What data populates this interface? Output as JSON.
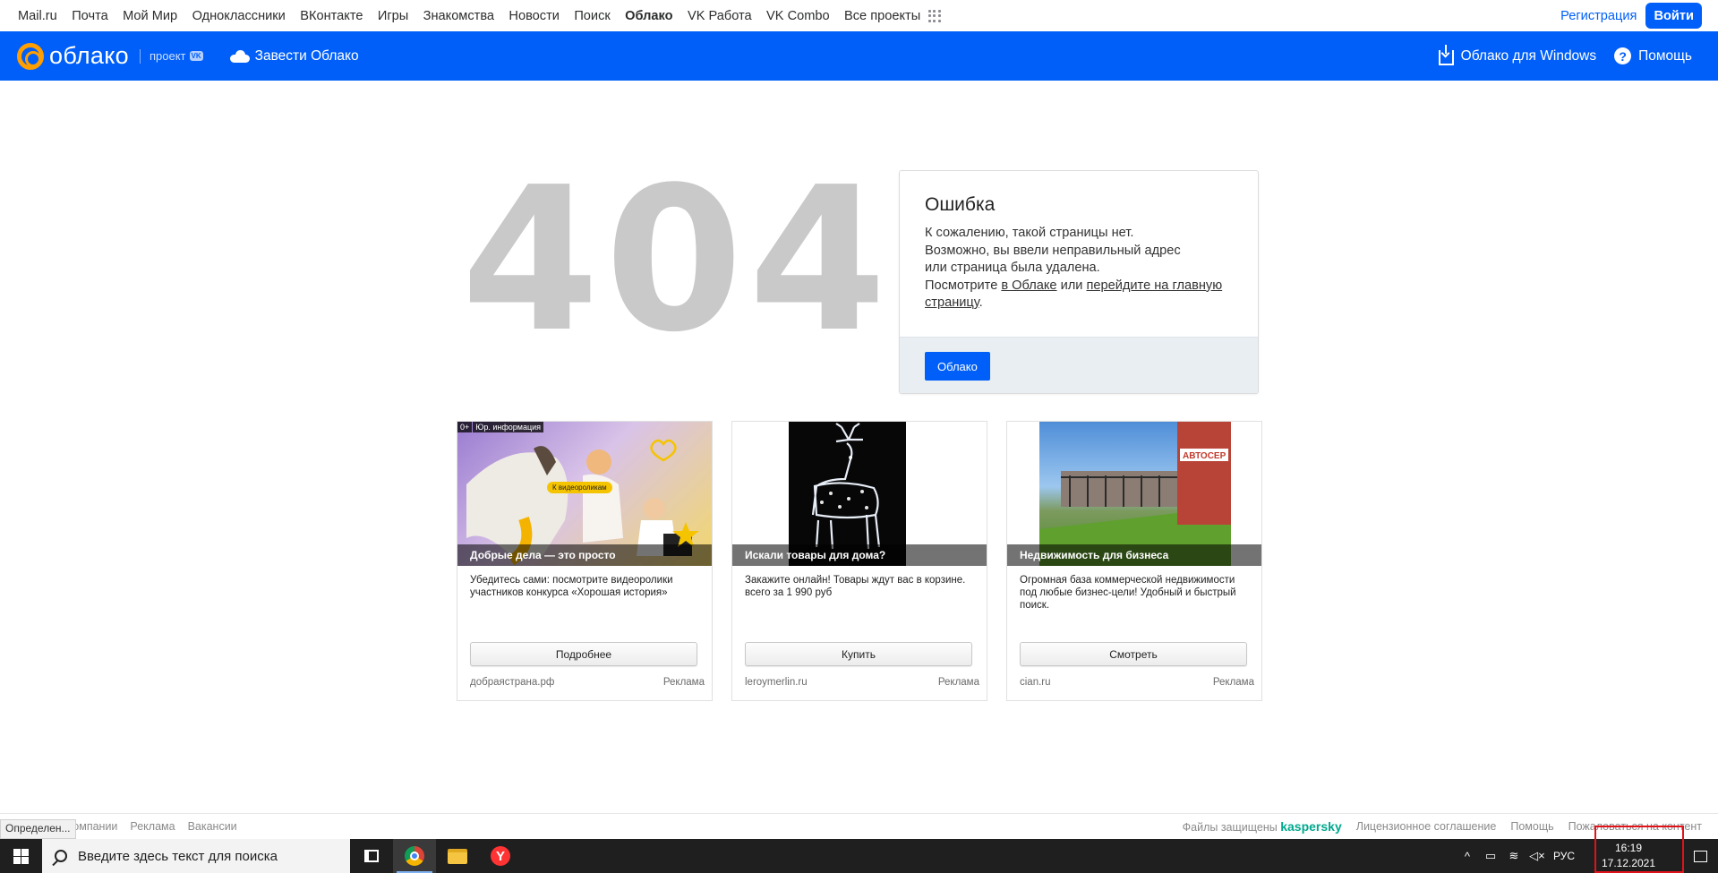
{
  "portal": {
    "links": [
      "Mail.ru",
      "Почта",
      "Мой Мир",
      "Одноклассники",
      "ВКонтакте",
      "Игры",
      "Знакомства",
      "Новости",
      "Поиск",
      "Облако",
      "VK Работа",
      "VK Combo",
      "Все проекты"
    ],
    "active": "Облако",
    "register": "Регистрация",
    "login": "Войти"
  },
  "header": {
    "logo_text": "облако",
    "project_label": "проект",
    "project_badge": "VK",
    "get_cloud": "Завести Облако",
    "windows": "Облако для Windows",
    "help": "Помощь"
  },
  "error": {
    "code": "404",
    "title": "Ошибка",
    "line1": "К сожалению, такой страницы нет.",
    "line2": "Возможно, вы ввели неправильный адрес",
    "line3": "или страница была удалена.",
    "line4_prefix": "Посмотрите ",
    "link_cloud": "в Облаке",
    "line4_mid": " или ",
    "link_main": "перейдите на главную страницу",
    "line4_end": ".",
    "button": "Облако"
  },
  "ads": [
    {
      "caption": "Добрые дела — это просто",
      "desc": "Убедитесь сами: посмотрите видеоролики участников конкурса «Хорошая история»",
      "button": "Подробнее",
      "domain": "добраястрана.рф",
      "label": "Реклама",
      "age": "0+",
      "legal": "Юр. информация",
      "overlay": "К видеороликам"
    },
    {
      "caption": "Искали товары для дома?",
      "desc": "Закажите онлайн! Товары ждут вас в корзине. всего за 1 990 руб",
      "button": "Купить",
      "domain": "leroymerlin.ru",
      "label": "Реклама"
    },
    {
      "caption": "Недвижимость для бизнеса",
      "desc": "Огромная база коммерческой недвижимости под любые бизнес-цели! Удобный и быстрый поиск.",
      "button": "Смотреть",
      "domain": "cian.ru",
      "label": "Реклама",
      "sign": "АВТОСЕР"
    }
  ],
  "footer": {
    "left": [
      "Компании",
      "Реклама",
      "Вакансии"
    ],
    "protected": "Файлы защищены",
    "kaspersky": "kaspersky",
    "license": "Лицензионное соглашение",
    "help": "Помощь",
    "report": "Пожаловаться на контент",
    "status_popup": "Определен..."
  },
  "taskbar": {
    "search_placeholder": "Введите здесь текст для поиска",
    "lang": "РУС",
    "time": "16:19",
    "date": "17.12.2021"
  }
}
